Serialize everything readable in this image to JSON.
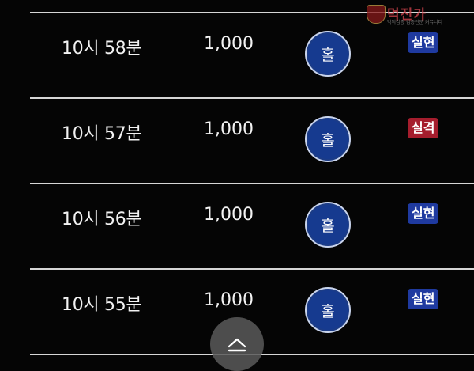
{
  "watermark": {
    "text": "먹진가",
    "subtext": "먹튀검증 검증전문 커뮤니티"
  },
  "rows": [
    {
      "time": "10시 58분",
      "amount": "1,000",
      "pick": "홀",
      "result": "실현",
      "result_type": "hit"
    },
    {
      "time": "10시 57분",
      "amount": "1,000",
      "pick": "홀",
      "result": "실격",
      "result_type": "miss"
    },
    {
      "time": "10시 56분",
      "amount": "1,000",
      "pick": "홀",
      "result": "실현",
      "result_type": "hit"
    },
    {
      "time": "10시 55분",
      "amount": "1,000",
      "pick": "홀",
      "result": "실현",
      "result_type": "hit"
    }
  ],
  "colors": {
    "background": "#050505",
    "pick_circle": "#163a8f",
    "hit_badge": "#1f3aa0",
    "miss_badge": "#a51d2d"
  },
  "scroll_top_icon": "chevron-up-icon"
}
